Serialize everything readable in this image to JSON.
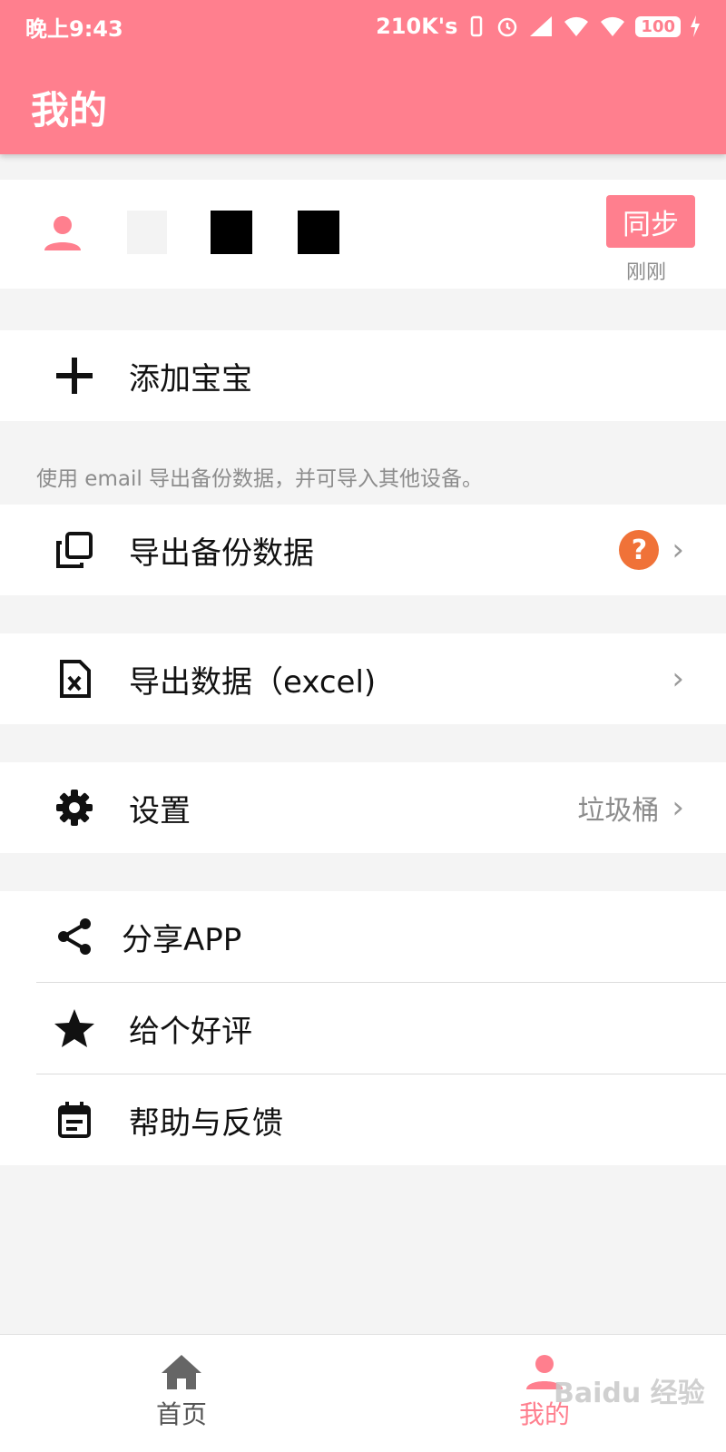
{
  "status_bar": {
    "time": "晚上9:43",
    "net_speed": "210K's",
    "battery": "100"
  },
  "app_bar": {
    "title": "我的"
  },
  "user": {
    "sync_label": "同步",
    "sync_time": "刚刚"
  },
  "add_baby": {
    "label": "添加宝宝"
  },
  "backup_hint": "使用 email 导出备份数据，并可导入其他设备。",
  "export_backup": {
    "label": "导出备份数据",
    "help": "?"
  },
  "export_excel": {
    "label": "导出数据（excel)"
  },
  "settings": {
    "label": "设置",
    "trash": "垃圾桶"
  },
  "menu": [
    {
      "label": "分享APP",
      "icon": "share-icon"
    },
    {
      "label": "给个好评",
      "icon": "star-icon"
    },
    {
      "label": "帮助与反馈",
      "icon": "feedback-icon"
    }
  ],
  "bottom_nav": [
    {
      "label": "首页",
      "icon": "home-icon"
    },
    {
      "label": "我的",
      "icon": "person-icon"
    }
  ],
  "watermark": "Baidu 经验",
  "colors": {
    "accent": "#ff7f8e",
    "help_orange": "#f07238",
    "background": "#f4f4f4"
  }
}
